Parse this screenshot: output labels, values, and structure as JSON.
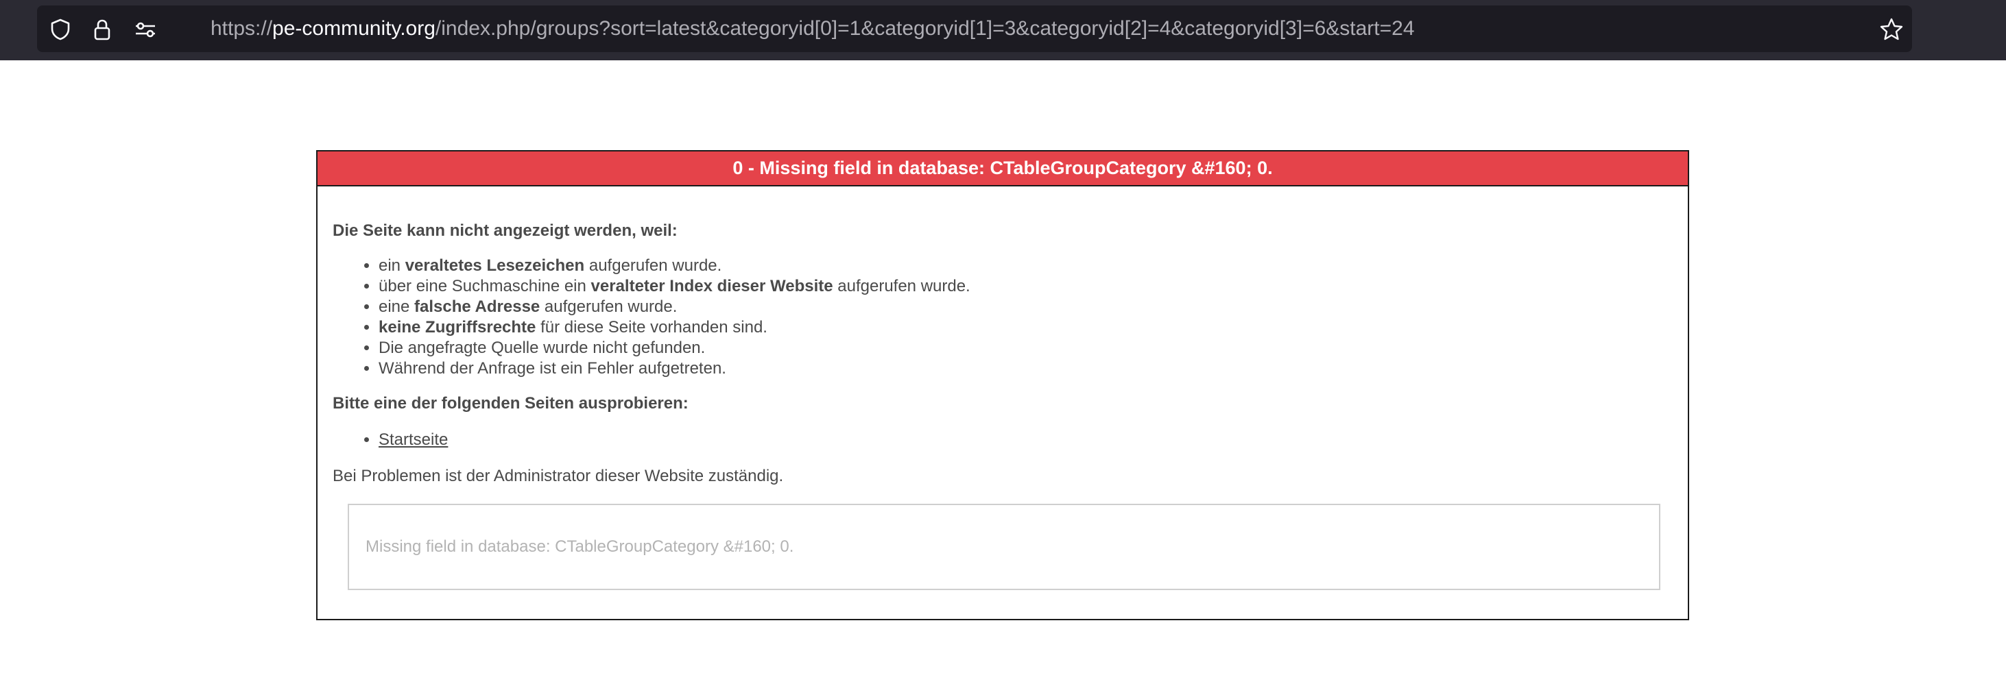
{
  "browser": {
    "url_scheme": "https://",
    "url_host": "pe-community.org",
    "url_path": "/index.php/groups?sort=latest&categoryid[0]=1&categoryid[1]=3&categoryid[2]=4&categoryid[3]=6&start=24",
    "icons": [
      "shield-icon",
      "lock-icon",
      "permissions-icon",
      "bookmark-star-icon"
    ]
  },
  "error": {
    "title": "0 - Missing field in database: CTableGroupCategory &#160; 0.",
    "intro": "Die Seite kann nicht angezeigt werden, weil:",
    "reasons": [
      {
        "pre": "ein ",
        "bold": "veraltetes Lesezeichen",
        "post": " aufgerufen wurde."
      },
      {
        "pre": "über eine Suchmaschine ein ",
        "bold": "veralteter Index dieser Website",
        "post": " aufgerufen wurde."
      },
      {
        "pre": "eine ",
        "bold": "falsche Adresse",
        "post": " aufgerufen wurde."
      },
      {
        "pre": "",
        "bold": "keine Zugriffsrechte",
        "post": " für diese Seite vorhanden sind."
      },
      {
        "pre": "Die angefragte Quelle wurde nicht gefunden.",
        "bold": "",
        "post": ""
      },
      {
        "pre": "Während der Anfrage ist ein Fehler aufgetreten.",
        "bold": "",
        "post": ""
      }
    ],
    "try_heading": "Bitte eine der folgenden Seiten ausprobieren:",
    "links": [
      {
        "label": "Startseite"
      }
    ],
    "admin_note": "Bei Problemen ist der Administrator dieser Website zuständig.",
    "detail": "Missing field in database: CTableGroupCategory &#160; 0."
  },
  "colors": {
    "header_bg": "#e5434a",
    "topbar_bg": "#2b2a33",
    "urlbar_bg": "#1c1b22"
  }
}
